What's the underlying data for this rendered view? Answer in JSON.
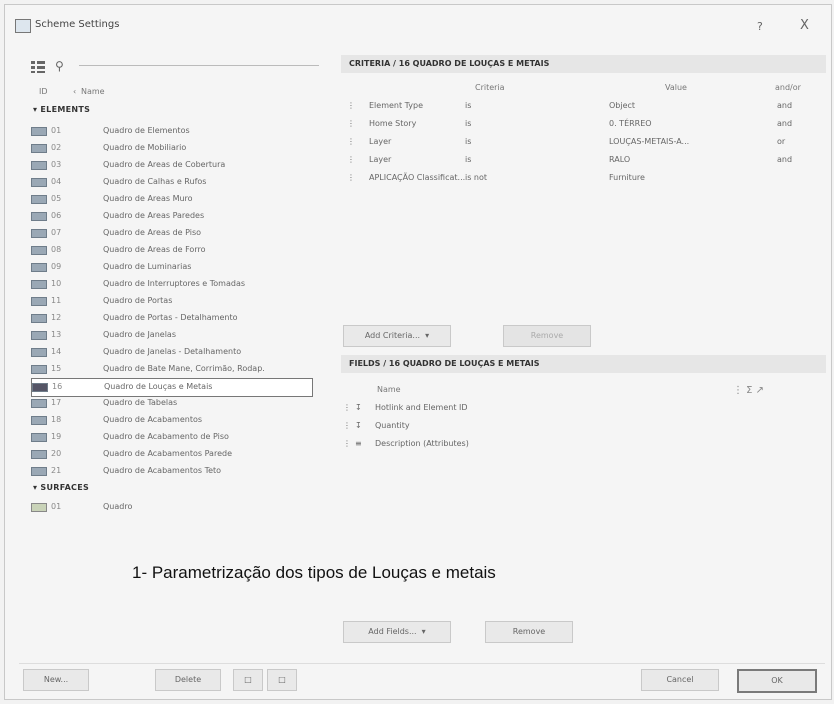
{
  "window": {
    "title": "Scheme Settings",
    "help": "?",
    "close": "X"
  },
  "left": {
    "columns": {
      "id": "ID",
      "name": "Name"
    },
    "elements_label": "ELEMENTS",
    "surfaces_label": "SURFACES",
    "items": [
      {
        "id": "01",
        "name": "Quadro de Elementos"
      },
      {
        "id": "02",
        "name": "Quadro de Mobiliario"
      },
      {
        "id": "03",
        "name": "Quadro de Areas de Cobertura"
      },
      {
        "id": "04",
        "name": "Quadro de Calhas e Rufos"
      },
      {
        "id": "05",
        "name": "Quadro de Areas Muro"
      },
      {
        "id": "06",
        "name": "Quadro de Areas Paredes"
      },
      {
        "id": "07",
        "name": "Quadro de Areas de Piso"
      },
      {
        "id": "08",
        "name": "Quadro de Areas de Forro"
      },
      {
        "id": "09",
        "name": "Quadro de Luminarias"
      },
      {
        "id": "10",
        "name": "Quadro de Interruptores e Tomadas"
      },
      {
        "id": "11",
        "name": "Quadro de Portas"
      },
      {
        "id": "12",
        "name": "Quadro de Portas - Detalhamento"
      },
      {
        "id": "13",
        "name": "Quadro de Janelas"
      },
      {
        "id": "14",
        "name": "Quadro de Janelas - Detalhamento"
      },
      {
        "id": "15",
        "name": "Quadro de Bate Mane, Corrimão, Rodap."
      },
      {
        "id": "16",
        "name": "Quadro de Louças e Metais"
      },
      {
        "id": "17",
        "name": "Quadro de Tabelas"
      },
      {
        "id": "18",
        "name": "Quadro de Acabamentos"
      },
      {
        "id": "19",
        "name": "Quadro de Acabamento de Piso"
      },
      {
        "id": "20",
        "name": "Quadro de Acabamentos Parede"
      },
      {
        "id": "21",
        "name": "Quadro de Acabamentos Teto"
      }
    ],
    "surface_items": [
      {
        "id": "01",
        "name": "Quadro"
      }
    ]
  },
  "criteria": {
    "header": "CRITERIA / 16 QUADRO DE LOUÇAS E METAIS",
    "columns": {
      "criteria": "Criteria",
      "value": "Value",
      "andor": "and/or"
    },
    "rows": [
      {
        "c1": "Element Type",
        "op": "is",
        "value": "Object",
        "andor": "and"
      },
      {
        "c1": "Home Story",
        "op": "is",
        "value": "0. TÉRREO",
        "andor": "and"
      },
      {
        "c1": "Layer",
        "op": "is",
        "value": "LOUÇAS-METAIS-A...",
        "andor": "or"
      },
      {
        "c1": "Layer",
        "op": "is",
        "value": "RALO",
        "andor": "and"
      },
      {
        "c1": "APLICAÇÃO Classificat...",
        "op": "is not",
        "value": "Furniture",
        "andor": ""
      }
    ],
    "add_label": "Add Criteria...",
    "remove_label": "Remove"
  },
  "fields": {
    "header": "FIELDS / 16 QUADRO DE LOUÇAS E METAIS",
    "column": "Name",
    "rows": [
      "Hotlink and Element ID",
      "Quantity",
      "Description (Attributes)"
    ],
    "add_label": "Add Fields...",
    "remove_label": "Remove"
  },
  "caption": "1- Parametrização dos tipos de Louças e metais",
  "footer": {
    "new": "New...",
    "delete": "Delete",
    "cancel": "Cancel",
    "ok": "OK"
  }
}
